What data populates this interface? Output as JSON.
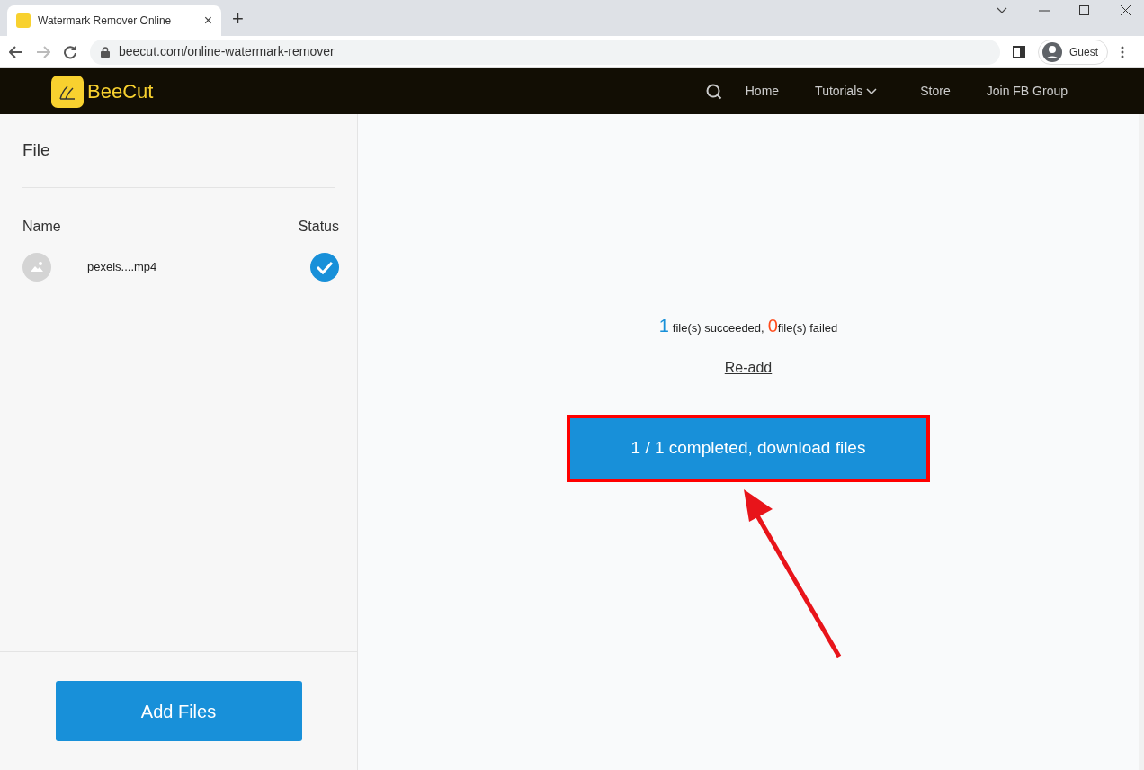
{
  "browser": {
    "tab": {
      "title": "Watermark Remover Online",
      "close": "×"
    },
    "new_tab": "+",
    "address": "beecut.com/online-watermark-remover",
    "profile": "Guest"
  },
  "site_nav": {
    "logo": "BeeCut",
    "links": [
      {
        "label": "Home",
        "dropdown": false
      },
      {
        "label": "Tutorials",
        "dropdown": true
      },
      {
        "label": "Store",
        "dropdown": false
      },
      {
        "label": "Join FB Group",
        "dropdown": false
      }
    ]
  },
  "sidebar": {
    "title": "File",
    "columns": [
      "Name",
      "Status"
    ],
    "files": [
      {
        "name": "pexels....mp4",
        "done": true
      }
    ],
    "add_button": "Add Files"
  },
  "result": {
    "succeeded_count": "1",
    "succeeded_text": "file(s) succeeded,",
    "failed_count": "0",
    "failed_text": "file(s) failed",
    "readd_link": "Re-add",
    "download_button": "1 / 1 completed, download files",
    "highlighted": true
  }
}
